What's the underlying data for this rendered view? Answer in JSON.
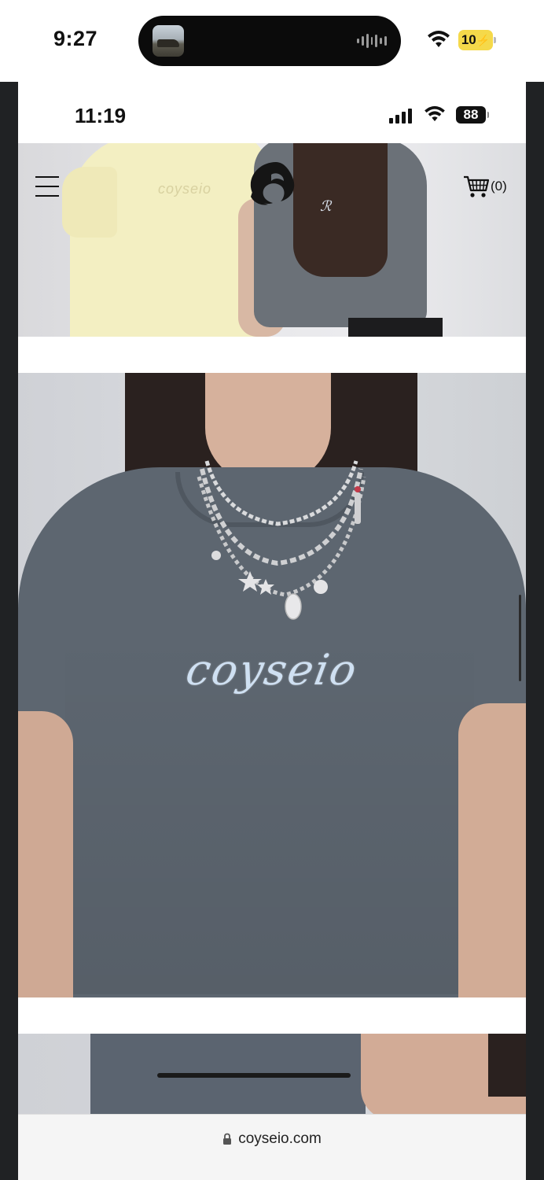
{
  "outer_status": {
    "time": "9:27",
    "battery": "10",
    "wifi_icon": "wifi-icon",
    "battery_color": "#f5d94a"
  },
  "inner_status": {
    "time": "11:19",
    "battery": "88",
    "signal_icon": "cellular-signal-icon",
    "wifi_icon": "wifi-icon"
  },
  "site_header": {
    "menu_icon": "hamburger-menu-icon",
    "logo_icon": "coyseio-logo-icon",
    "cart_icon": "shopping-cart-icon",
    "cart_count": "(0)"
  },
  "products": {
    "print_text": "coyseio",
    "shirt_color": "#5d6670"
  },
  "browser": {
    "lock_icon": "lock-icon",
    "url": "coyseio.com"
  }
}
